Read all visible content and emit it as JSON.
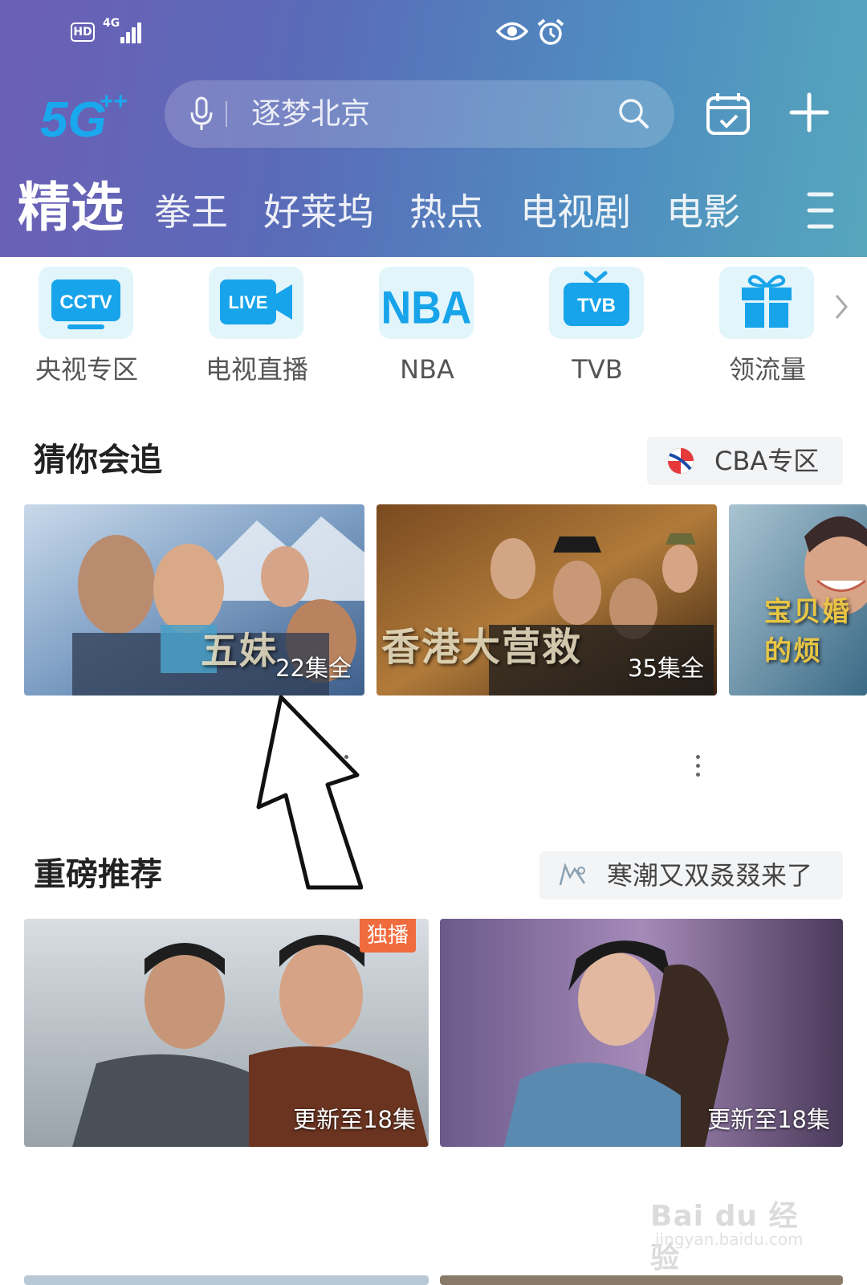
{
  "status_bar": {
    "hd": "HD",
    "network": "4G"
  },
  "header": {
    "logo": "5G++",
    "search": {
      "placeholder": "逐梦北京"
    },
    "icons": [
      "mic-icon",
      "search-icon",
      "calendar-icon",
      "plus-icon"
    ]
  },
  "tabs": [
    {
      "label": "精选",
      "active": true
    },
    {
      "label": "拳王"
    },
    {
      "label": "好莱坞"
    },
    {
      "label": "热点"
    },
    {
      "label": "电视剧"
    },
    {
      "label": "电影"
    }
  ],
  "shortcuts": [
    {
      "label": "央视专区",
      "tile_text": "CCTV",
      "icon": "cctv-icon"
    },
    {
      "label": "电视直播",
      "tile_text": "LIVE",
      "icon": "live-icon"
    },
    {
      "label": "NBA",
      "tile_text": "NBA",
      "icon": "nba-icon"
    },
    {
      "label": "TVB",
      "tile_text": "TVB",
      "icon": "tvb-icon"
    },
    {
      "label": "领流量",
      "icon": "gift-icon"
    }
  ],
  "section_guess": {
    "title": "猜你会追",
    "tag": "CBA专区",
    "cards": [
      {
        "overlay_title": "五妹",
        "caption": "22集全"
      },
      {
        "overlay_title": "香港大营救",
        "caption": "35集全"
      },
      {
        "overlay_title": "宝贝婚的烦"
      }
    ]
  },
  "section_recommend": {
    "title": "重磅推荐",
    "tag": "寒潮又双叒叕来了",
    "cards": [
      {
        "badge": "独播",
        "caption": "更新至18集"
      },
      {
        "caption": "更新至18集"
      }
    ]
  },
  "watermark": {
    "text": "Bai du 经验",
    "sub": "jingyan.baidu.com"
  },
  "colors": {
    "accent": "#1ba3e8",
    "header_start": "#6c5fb6",
    "header_end": "#56a6bd",
    "badge": "#f06b3d"
  }
}
